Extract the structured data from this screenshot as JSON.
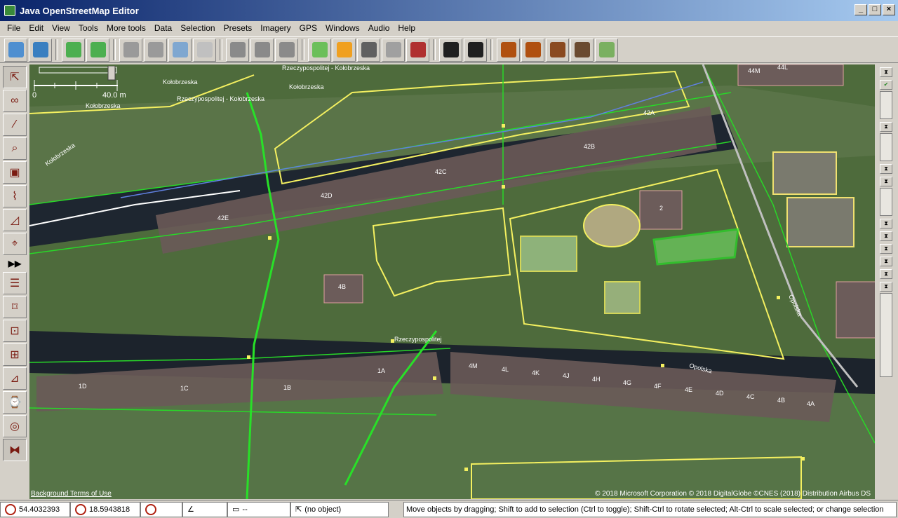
{
  "window": {
    "title": "Java OpenStreetMap Editor"
  },
  "menu": [
    "File",
    "Edit",
    "View",
    "Tools",
    "More tools",
    "Data",
    "Selection",
    "Presets",
    "Imagery",
    "GPS",
    "Windows",
    "Audio",
    "Help"
  ],
  "toolbar": {
    "buttons": [
      {
        "name": "open-file",
        "color": "#4f8fd0"
      },
      {
        "name": "open-location",
        "color": "#3a7fc0"
      },
      {
        "name": "download",
        "color": "#4caf50"
      },
      {
        "name": "upload",
        "color": "#4caf50"
      },
      {
        "name": "undo",
        "color": "#9a9a9a"
      },
      {
        "name": "redo",
        "color": "#9a9a9a"
      },
      {
        "name": "zoom-to-selection",
        "color": "#7fa7d0"
      },
      {
        "name": "preferences",
        "color": "#c0c0c0"
      },
      {
        "name": "split-way",
        "color": "#8a8a8a"
      },
      {
        "name": "combine-way",
        "color": "#8a8a8a"
      },
      {
        "name": "reverse-way",
        "color": "#8a8a8a"
      },
      {
        "name": "simplify",
        "color": "#6bbf5a"
      },
      {
        "name": "highway-preset",
        "color": "#f0a020"
      },
      {
        "name": "road-preset",
        "color": "#606060"
      },
      {
        "name": "traffic-signals",
        "color": "#a0a0a0"
      },
      {
        "name": "wall-preset",
        "color": "#b03030"
      },
      {
        "name": "car-preset",
        "color": "#202020"
      },
      {
        "name": "bus-preset",
        "color": "#202020"
      },
      {
        "name": "amenity-preset",
        "color": "#b05010"
      },
      {
        "name": "restaurant-preset",
        "color": "#b05010"
      },
      {
        "name": "castle-preset",
        "color": "#8a4a20"
      },
      {
        "name": "industrial-preset",
        "color": "#6a4a30"
      },
      {
        "name": "attraction-preset",
        "color": "#7ab060"
      }
    ]
  },
  "map": {
    "scale_label": "40.0 m",
    "scale_zero": "0",
    "attribution": "© 2018 Microsoft Corporation © 2018 DigitalGlobe ©CNES (2018) Distribution Airbus DS",
    "terms": "Background Terms of Use",
    "labels": [
      "Kołobrzeska",
      "Rzeczypospolitej - Kołobrzeska",
      "Kołobrzeska",
      "Rzeczypospolitej - Kołobrzeska",
      "Kołobrzeska",
      "Kołobrzeska",
      "Rzeczypospolitej",
      "Opolska",
      "Opolska",
      "42A",
      "42B",
      "42C",
      "42D",
      "42E",
      "4B",
      "2",
      "1D",
      "1C",
      "1B",
      "1A",
      "4M",
      "4L",
      "4K",
      "4J",
      "4H",
      "4G",
      "4F",
      "4E",
      "4D",
      "4C",
      "4B",
      "4A",
      "44M",
      "44L"
    ]
  },
  "status": {
    "lat": "54.4032393",
    "lon": "18.5943818",
    "heading": "",
    "angle": "",
    "distance": "--",
    "object": "(no object)",
    "message": "Move objects by dragging; Shift to add to selection (Ctrl to toggle); Shift-Ctrl to rotate selected; Alt-Ctrl to scale selected; or change selection"
  }
}
